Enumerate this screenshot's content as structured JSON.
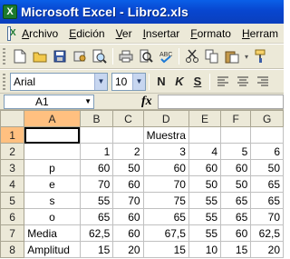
{
  "window": {
    "title": "Microsoft Excel - Libro2.xls"
  },
  "menu": [
    {
      "label": "Archivo"
    },
    {
      "label": "Edición"
    },
    {
      "label": "Ver"
    },
    {
      "label": "Insertar"
    },
    {
      "label": "Formato"
    },
    {
      "label": "Herram"
    }
  ],
  "toolbar": {
    "icons": [
      "new-icon",
      "open-icon",
      "save-icon",
      "permission-icon",
      "print-preview-icon",
      "print-icon",
      "spelling-icon",
      "cut-icon",
      "copy-icon",
      "paste-icon",
      "format-painter-icon"
    ]
  },
  "format": {
    "font": "Arial",
    "size": "10",
    "bold": "N",
    "italic": "K",
    "underline": "S"
  },
  "formula": {
    "cell_ref": "A1",
    "fx": "fx",
    "value": ""
  },
  "sheet": {
    "columns": [
      "A",
      "B",
      "C",
      "D",
      "E",
      "F",
      "G"
    ],
    "rows": [
      {
        "n": "1",
        "cells": [
          "",
          "",
          "",
          "Muestra",
          "",
          "",
          ""
        ]
      },
      {
        "n": "2",
        "cells": [
          "",
          "1",
          "2",
          "3",
          "4",
          "5",
          "6"
        ]
      },
      {
        "n": "3",
        "cells": [
          "p",
          "60",
          "50",
          "60",
          "60",
          "60",
          "50"
        ]
      },
      {
        "n": "4",
        "cells": [
          "e",
          "70",
          "60",
          "70",
          "50",
          "50",
          "65"
        ]
      },
      {
        "n": "5",
        "cells": [
          "s",
          "55",
          "70",
          "75",
          "55",
          "65",
          "65"
        ]
      },
      {
        "n": "6",
        "cells": [
          "o",
          "65",
          "60",
          "65",
          "55",
          "65",
          "70"
        ]
      },
      {
        "n": "7",
        "cells": [
          "Media",
          "62,5",
          "60",
          "67,5",
          "55",
          "60",
          "62,5"
        ]
      },
      {
        "n": "8",
        "cells": [
          "Amplitud",
          "15",
          "20",
          "15",
          "10",
          "15",
          "20"
        ]
      }
    ]
  }
}
